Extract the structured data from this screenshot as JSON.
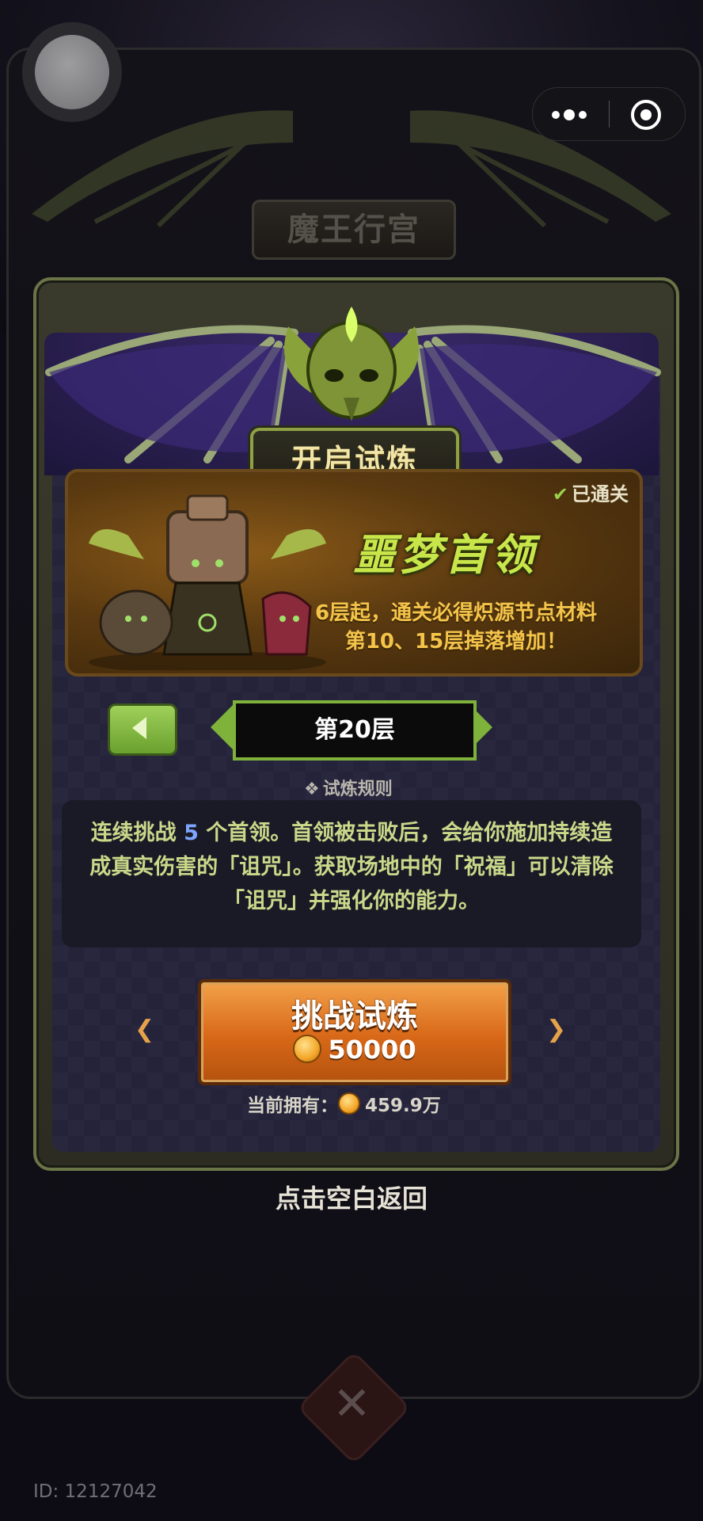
{
  "background": {
    "palace_title": "魔王行宫"
  },
  "top_bar": {
    "home_icon": "circle-home-icon",
    "more_icon": "more-dots-icon",
    "close_icon": "target-circle-icon"
  },
  "trial": {
    "header_title": "开启试炼",
    "status": "已通关",
    "boss_name": "噩梦首领",
    "boss_desc_line1": "6层起，通关必得炽源节点材料",
    "boss_desc_line2": "第10、15层掉落增加！",
    "floor_label": "第20层",
    "rules_title": "试炼规则",
    "rules_part1": "连续挑战 ",
    "rules_count": "5",
    "rules_part2": " 个首领。首领被击败后，会给你施加持续造成真实伤害的「诅咒」。获取场地中的「祝福」可以清除「诅咒」并强化你的能力。",
    "challenge_label": "挑战试炼",
    "challenge_cost": "50000",
    "owned_label": "当前拥有：",
    "owned_value": "459.9万"
  },
  "footer": {
    "tap_back": "点击空白返回",
    "id_text": "ID: 12127042"
  },
  "colors": {
    "accent_green": "#7fb23a",
    "boss_name": "#c8e64a",
    "boss_desc": "#f4c44a",
    "button_orange": "#d86818"
  }
}
